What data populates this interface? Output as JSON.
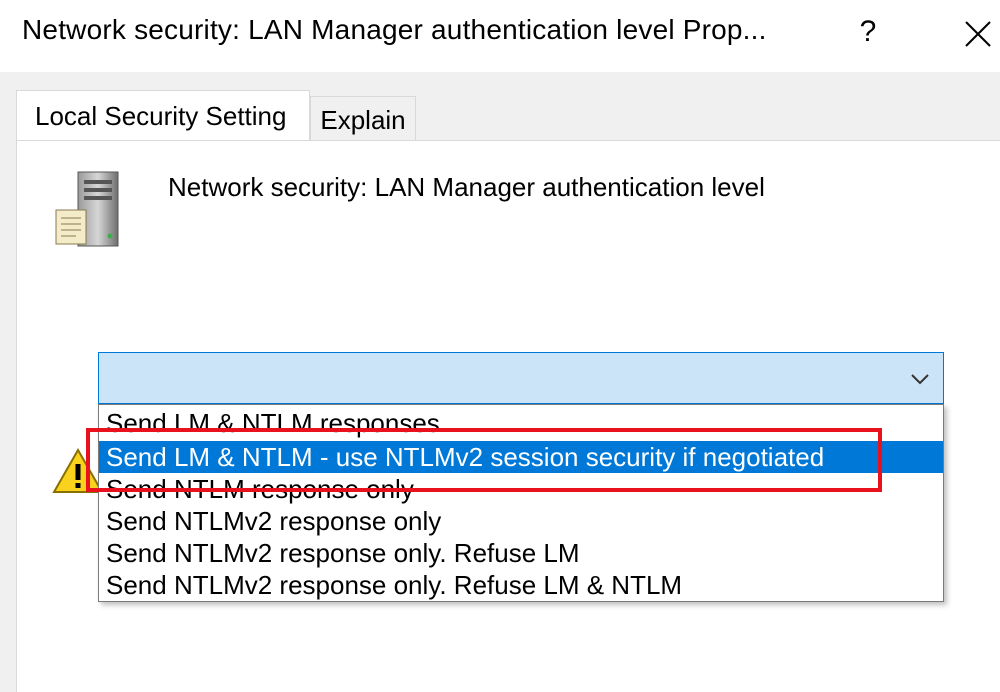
{
  "window": {
    "title": "Network security: LAN Manager authentication level Prop...",
    "help_label": "?",
    "close_icon": "close-icon"
  },
  "tabs": [
    {
      "label": "Local Security Setting",
      "active": true
    },
    {
      "label": "Explain",
      "active": false
    }
  ],
  "policy": {
    "name": "Network security: LAN Manager authentication level",
    "icon": "server-policy-icon"
  },
  "warning": {
    "icon": "warning-icon"
  },
  "combo": {
    "selected_value": "",
    "chevron_icon": "chevron-down-icon"
  },
  "dropdown": {
    "options": [
      "Send LM & NTLM responses",
      "Send LM & NTLM - use NTLMv2 session security if negotiated",
      "Send NTLM response only",
      "Send NTLMv2 response only",
      "Send NTLMv2 response only. Refuse LM",
      "Send NTLMv2 response only. Refuse LM & NTLM"
    ],
    "highlighted_index": 1
  },
  "colors": {
    "selection": "#0078d7",
    "combo_background": "#cce4f7",
    "annotation_border": "#e8111d"
  }
}
